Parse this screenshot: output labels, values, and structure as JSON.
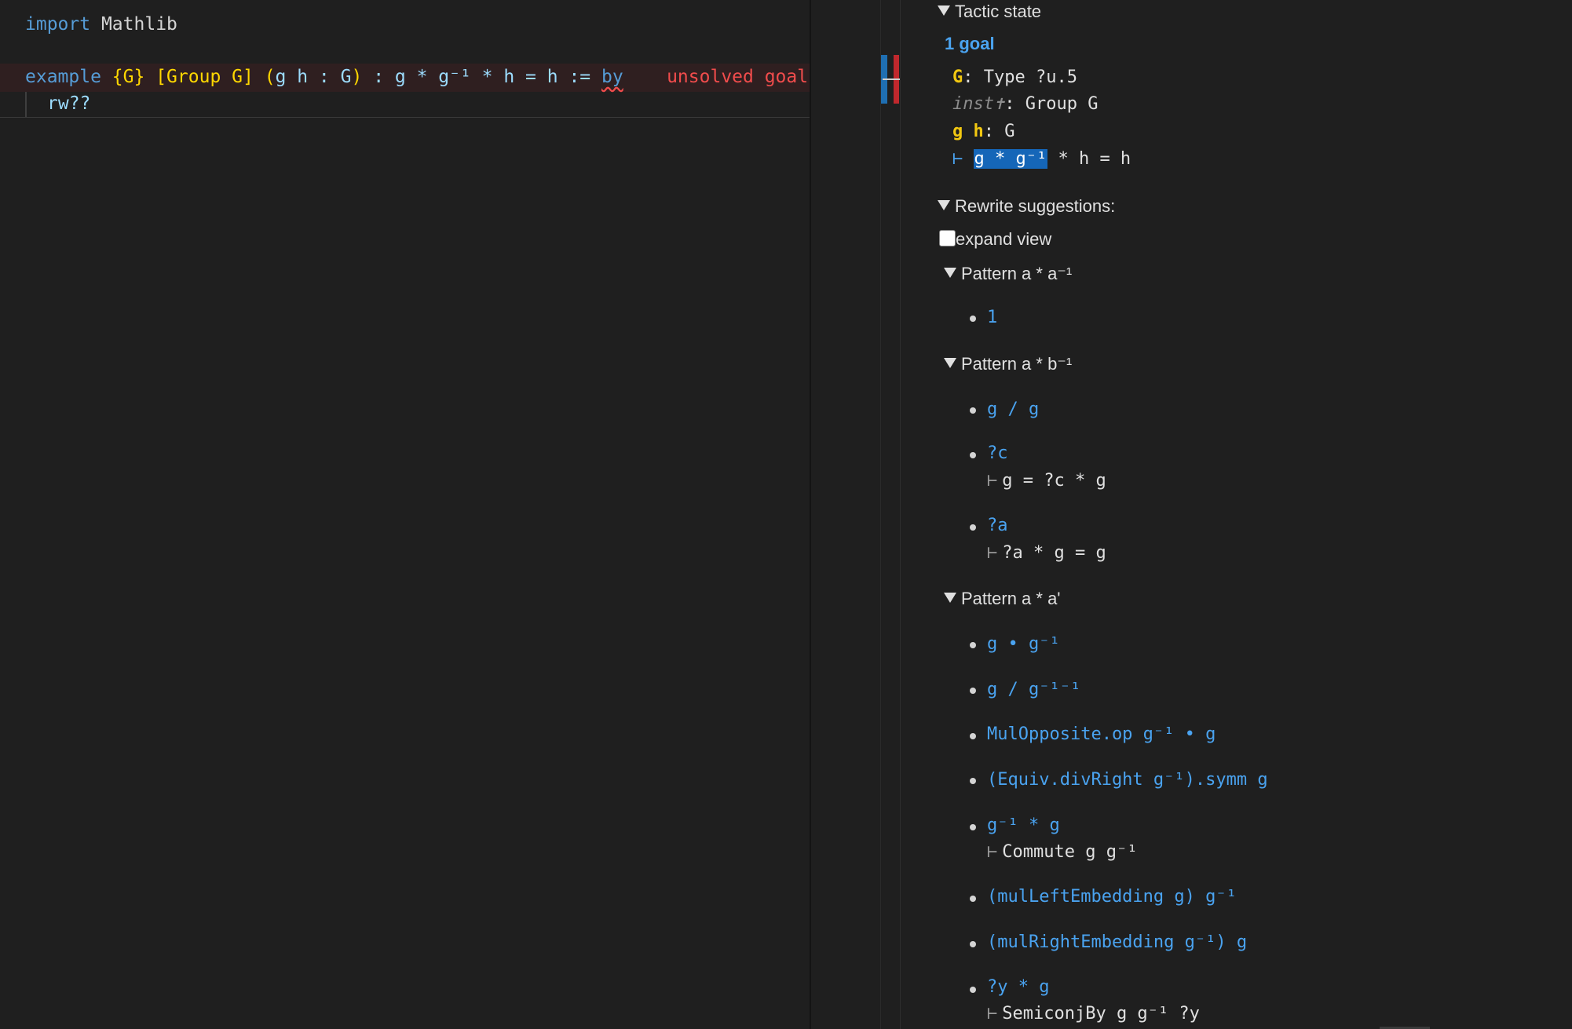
{
  "editor": {
    "line1": {
      "keyword": "import",
      "module": "Mathlib"
    },
    "line2": {
      "keyword": "example",
      "binder1": "{G}",
      "binder2": "[Group G]",
      "binder3_open": "(",
      "binder3_vars": "g h : G",
      "binder3_close": ")",
      "type": " : g * g⁻¹ * h = h := ",
      "by": "by",
      "error": "unsolved goals"
    },
    "line3": "rw??"
  },
  "infoview": {
    "tactic_state_header": "Tactic state",
    "goal_count": "1 goal",
    "hyps": [
      {
        "names": "G",
        "type": ": Type ?u.5"
      },
      {
        "names": "inst✝",
        "type": ": Group G"
      },
      {
        "names": "g h",
        "type": ": G"
      }
    ],
    "goal": {
      "turnstile": "⊢",
      "highlighted": "g * g⁻¹",
      "rest": " * h = h"
    },
    "rewrite_header": "Rewrite suggestions:",
    "expand_view_label": "expand view",
    "patterns": [
      {
        "label": "Pattern a * a⁻¹",
        "items": [
          {
            "text": "1"
          }
        ]
      },
      {
        "label": "Pattern a * b⁻¹",
        "items": [
          {
            "text": "g / g"
          },
          {
            "text": "?c",
            "side": "g = ?c * g"
          },
          {
            "text": "?a",
            "side": "?a * g = g"
          }
        ]
      },
      {
        "label": "Pattern a * a'",
        "items": [
          {
            "text": "g • g⁻¹"
          },
          {
            "text": "g / g⁻¹⁻¹"
          },
          {
            "text": "MulOpposite.op g⁻¹ • g"
          },
          {
            "text": "(Equiv.divRight g⁻¹).symm g"
          },
          {
            "text": "g⁻¹ * g",
            "side": "Commute g g⁻¹"
          },
          {
            "text": "(mulLeftEmbedding g) g⁻¹"
          },
          {
            "text": "(mulRightEmbedding g⁻¹) g"
          },
          {
            "text": "?y * g",
            "side": "SemiconjBy g g⁻¹ ?y"
          }
        ]
      }
    ]
  }
}
